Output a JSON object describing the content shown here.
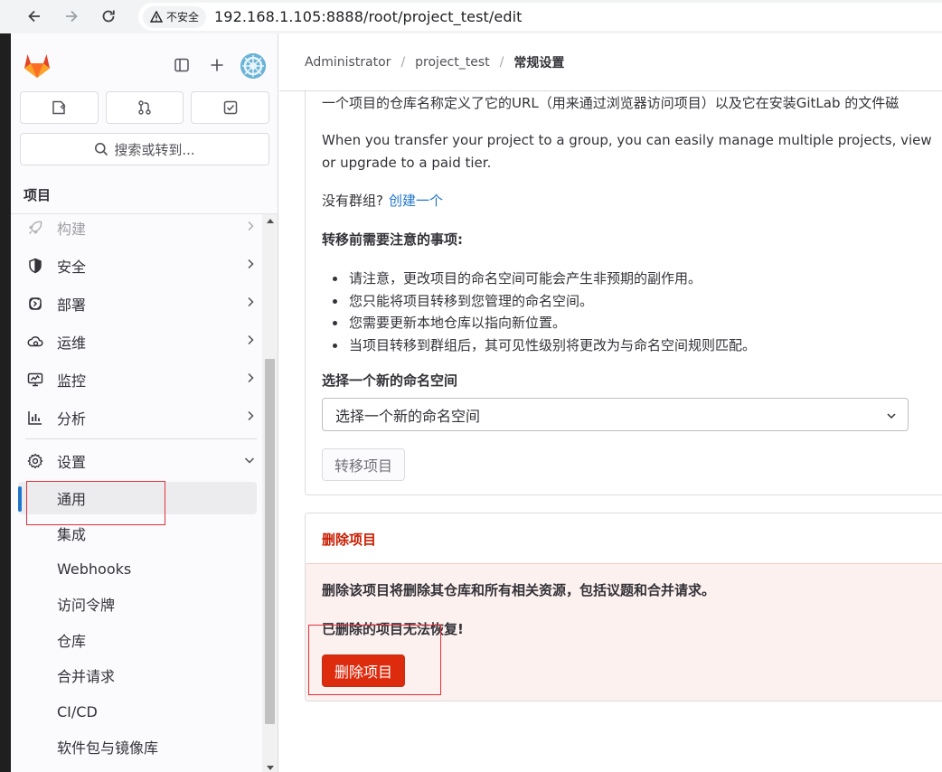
{
  "browser": {
    "security_label": "不安全",
    "url": "192.168.1.105:8888/root/project_test/edit"
  },
  "sidebar": {
    "search_label": "搜索或转到...",
    "section_title": "项目",
    "nav": [
      {
        "label": "构建",
        "icon": "rocket-icon"
      },
      {
        "label": "安全",
        "icon": "shield-icon"
      },
      {
        "label": "部署",
        "icon": "deploy-icon"
      },
      {
        "label": "运维",
        "icon": "cloud-gear-icon"
      },
      {
        "label": "监控",
        "icon": "monitor-icon"
      },
      {
        "label": "分析",
        "icon": "chart-icon"
      },
      {
        "label": "设置",
        "icon": "settings-icon"
      }
    ],
    "settings_sub": [
      "通用",
      "集成",
      "Webhooks",
      "访问令牌",
      "仓库",
      "合并请求",
      "CI/CD",
      "软件包与镜像库"
    ]
  },
  "breadcrumb": {
    "items": [
      "Administrator",
      "project_test",
      "常规设置"
    ]
  },
  "transfer": {
    "intro_text": "一个项目的仓库名称定义了它的URL（用来通过浏览器访问项目）以及它在安装GitLab 的文件磁",
    "group_text_1": "When you transfer your project to a group, you can easily manage multiple projects, view",
    "group_text_2": "or upgrade to a paid tier.",
    "no_group": "没有群组?",
    "create_link": "创建一个",
    "notes_title": "转移前需要注意的事项:",
    "notes": [
      "请注意，更改项目的命名空间可能会产生非预期的副作用。",
      "您只能将项目转移到您管理的命名空间。",
      "您需要更新本地仓库以指向新位置。",
      "当项目转移到群组后，其可见性级别将更改为与命名空间规则匹配。"
    ],
    "namespace_label": "选择一个新的命名空间",
    "namespace_placeholder": "选择一个新的命名空间",
    "transfer_button": "转移项目"
  },
  "delete": {
    "title": "删除项目",
    "warning": "删除该项目将删除其仓库和所有相关资源，包括议题和合并请求。",
    "irreversible": "已删除的项目无法恢复!",
    "button": "删除项目"
  },
  "colors": {
    "danger": "#dd2b0e",
    "link": "#1f75cb",
    "annotation": "#e0323a"
  }
}
